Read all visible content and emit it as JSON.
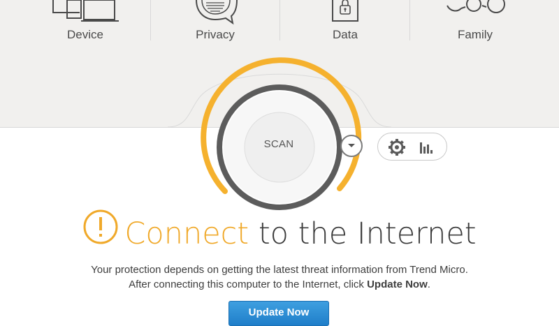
{
  "nav": {
    "items": [
      {
        "label": "Device",
        "icon": "devices-icon"
      },
      {
        "label": "Privacy",
        "icon": "chat-bubble-icon"
      },
      {
        "label": "Data",
        "icon": "lock-folder-icon"
      },
      {
        "label": "Family",
        "icon": "family-icon"
      }
    ]
  },
  "scan": {
    "label": "SCAN"
  },
  "status": {
    "accent_word": "Connect",
    "rest": " to the Internet",
    "line1": "Your protection depends on getting the latest threat information from Trend Micro.",
    "line2_prefix": "After connecting this computer to the Internet, click ",
    "line2_bold": "Update Now",
    "line2_suffix": "."
  },
  "update_button": {
    "label": "Update Now"
  },
  "colors": {
    "accent": "#f0a92a",
    "button": "#2a8bd6"
  }
}
